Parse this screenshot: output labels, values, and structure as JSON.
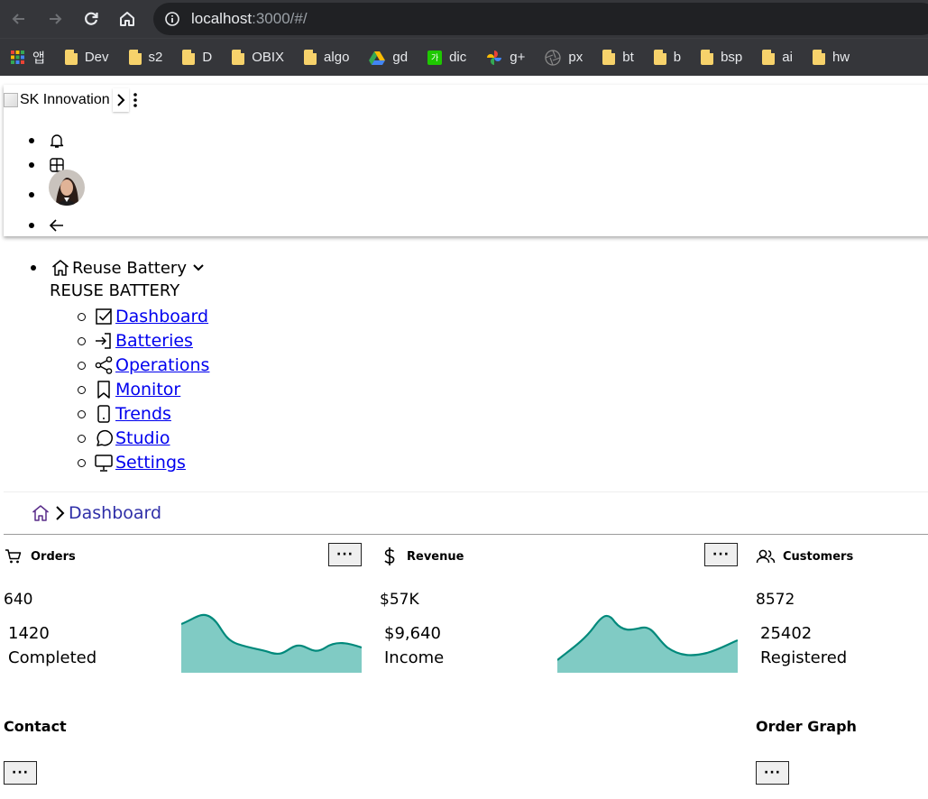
{
  "browser": {
    "url_host": "localhost",
    "url_rest": ":3000/#/",
    "bookmarks": [
      {
        "label": "앱",
        "icon": "apps-grid-icon"
      },
      {
        "label": "Dev",
        "icon": "folder-icon"
      },
      {
        "label": "s2",
        "icon": "folder-icon"
      },
      {
        "label": "D",
        "icon": "folder-icon"
      },
      {
        "label": "OBIX",
        "icon": "folder-icon"
      },
      {
        "label": "algo",
        "icon": "folder-icon"
      },
      {
        "label": "gd",
        "icon": "google-drive-icon"
      },
      {
        "label": "dic",
        "icon": "dictionary-icon"
      },
      {
        "label": "g+",
        "icon": "pinwheel-icon"
      },
      {
        "label": "px",
        "icon": "aperture-icon"
      },
      {
        "label": "bt",
        "icon": "folder-icon"
      },
      {
        "label": "b",
        "icon": "folder-icon"
      },
      {
        "label": "bsp",
        "icon": "folder-icon"
      },
      {
        "label": "ai",
        "icon": "folder-icon"
      },
      {
        "label": "hw",
        "icon": "folder-icon"
      }
    ],
    "dic_badge": "가"
  },
  "header": {
    "logo_alt": "SK Innovation"
  },
  "menu": {
    "root_label": "Reuse Battery",
    "section_heading": "REUSE BATTERY",
    "items": [
      {
        "label": "Dashboard",
        "icon": "checkbox-icon"
      },
      {
        "label": "Batteries",
        "icon": "login-arrow-icon"
      },
      {
        "label": "Operations",
        "icon": "share-icon"
      },
      {
        "label": "Monitor",
        "icon": "bookmark-icon"
      },
      {
        "label": "Trends",
        "icon": "tablet-icon"
      },
      {
        "label": "Studio",
        "icon": "chat-bubble-icon"
      },
      {
        "label": "Settings",
        "icon": "monitor-icon"
      }
    ]
  },
  "breadcrumb": {
    "current": "Dashboard"
  },
  "cards": [
    {
      "title": "Orders",
      "icon": "cart-icon",
      "value": "640",
      "sub_value": "1420",
      "sub_label": "Completed",
      "menu": "···"
    },
    {
      "title": "Revenue",
      "icon": "dollar-icon",
      "value": "$57K",
      "sub_value": "$9,640",
      "sub_label": "Income",
      "menu": "···"
    },
    {
      "title": "Customers",
      "icon": "users-icon",
      "value": "8572",
      "sub_value": "25402",
      "sub_label": "Registered"
    }
  ],
  "sections": {
    "contact": "Contact",
    "order_graph": "Order Graph",
    "menu": "···"
  },
  "colors": {
    "spark_fill": "#80cbc4",
    "spark_stroke": "#00897b",
    "link": "#0000ee"
  }
}
